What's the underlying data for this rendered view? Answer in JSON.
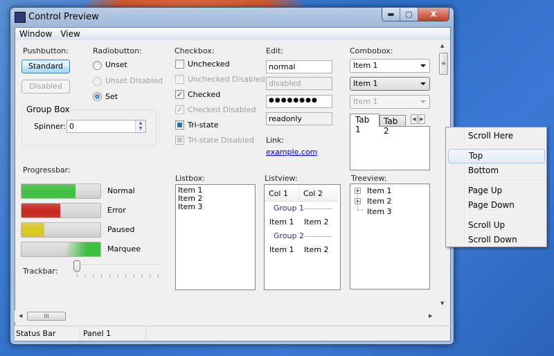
{
  "window": {
    "title": "Control Preview",
    "minimize": "▬",
    "maximize": "▢",
    "close": "X"
  },
  "menubar": [
    "Window",
    "View"
  ],
  "pushbutton": {
    "label": "Pushbutton:",
    "standard": "Standard",
    "disabled": "Disabled"
  },
  "radiobutton": {
    "label": "Radiobutton:",
    "items": [
      "Unset",
      "Unset Disabled",
      "Set"
    ]
  },
  "groupbox": {
    "title": "Group Box",
    "spinner_label": "Spinner:",
    "spinner_value": "0"
  },
  "checkbox": {
    "label": "Checkbox:",
    "items": [
      "Unchecked",
      "Unchecked Disabled",
      "Checked",
      "Checked Disabled",
      "Tri-state",
      "Tri-state Disabled"
    ]
  },
  "edit": {
    "label": "Edit:",
    "normal": "normal",
    "disabled": "disabled",
    "password": "●●●●●●●●",
    "readonly": "readonly"
  },
  "link": {
    "label": "Link:",
    "text": "example.com"
  },
  "combobox": {
    "label": "Combobox:",
    "values": [
      "Item 1",
      "Item 1",
      "Item 1"
    ]
  },
  "tabs": [
    "Tab 1",
    "Tab 2"
  ],
  "progressbar": {
    "label": "Progressbar:",
    "bars": [
      {
        "label": "Normal",
        "value": 68,
        "color": "#3fbf3f"
      },
      {
        "label": "Error",
        "value": 49,
        "color": "#c8281e"
      },
      {
        "label": "Paused",
        "value": 29,
        "color": "#d8c81e"
      },
      {
        "label": "Marquee",
        "value": null,
        "color": "#3fbf3f"
      }
    ]
  },
  "trackbar": {
    "label": "Trackbar:",
    "value": 0
  },
  "listbox": {
    "label": "Listbox:",
    "items": [
      "Item 1",
      "Item 2",
      "Item 3"
    ]
  },
  "listview": {
    "label": "Listview:",
    "columns": [
      "Col 1",
      "Col 2"
    ],
    "groups": [
      {
        "name": "Group 1",
        "row": [
          "Item 1",
          "Item 2"
        ]
      },
      {
        "name": "Group 2",
        "row": [
          "Item 1",
          "Item 2"
        ]
      }
    ]
  },
  "treeview": {
    "label": "Treeview:",
    "items": [
      "Item 1",
      "Item 2",
      "Item 3"
    ]
  },
  "statusbar": [
    "Status Bar",
    "Panel 1"
  ],
  "context_menu": [
    "Scroll Here",
    "Top",
    "Bottom",
    "Page Up",
    "Page Down",
    "Scroll Up",
    "Scroll Down"
  ]
}
